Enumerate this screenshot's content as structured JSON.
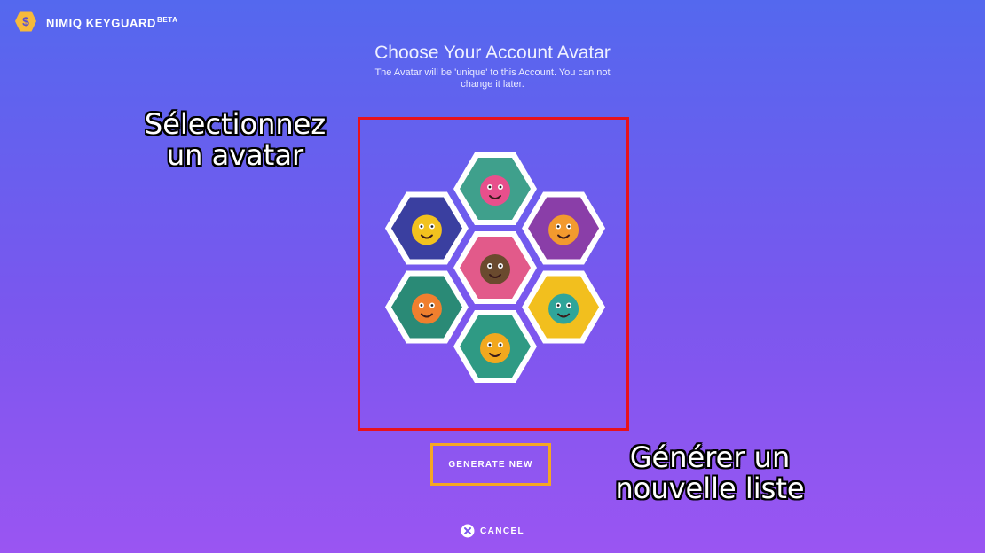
{
  "app": {
    "name": "NIMIQ KEYGUARD",
    "badge": "BETA"
  },
  "page": {
    "title": "Choose Your Account Avatar",
    "subtitle": "The Avatar will be 'unique' to this Account. You can not change it later."
  },
  "avatars": [
    {
      "id": "chef-teapot",
      "bg": "#3fa08c",
      "fg": "#e84f8c"
    },
    {
      "id": "winged-orange-right",
      "bg": "#8a3ea8",
      "fg": "#f29a2e"
    },
    {
      "id": "water-drop",
      "bg": "#f2bf1e",
      "fg": "#2fa59a"
    },
    {
      "id": "dumbbell-orange",
      "bg": "#2f9a84",
      "fg": "#f2a81e"
    },
    {
      "id": "tennis-orange",
      "bg": "#2a8a76",
      "fg": "#f07f2e"
    },
    {
      "id": "winged-orange-left",
      "bg": "#3a3fa0",
      "fg": "#f2c21e"
    },
    {
      "id": "skater-kiwi",
      "bg": "#e25a8a",
      "fg": "#6a4a2e"
    }
  ],
  "annotations": {
    "select_line1": "Sélectionnez",
    "select_line2": "un avatar",
    "generate_line1": "Générer un",
    "generate_line2": "nouvelle liste"
  },
  "actions": {
    "generate": "GENERATE NEW",
    "cancel": "CANCEL"
  },
  "colors": {
    "annotation_select_box": "#e8121c",
    "annotation_generate_box": "#f5a623",
    "brand": "#f6b93b"
  }
}
